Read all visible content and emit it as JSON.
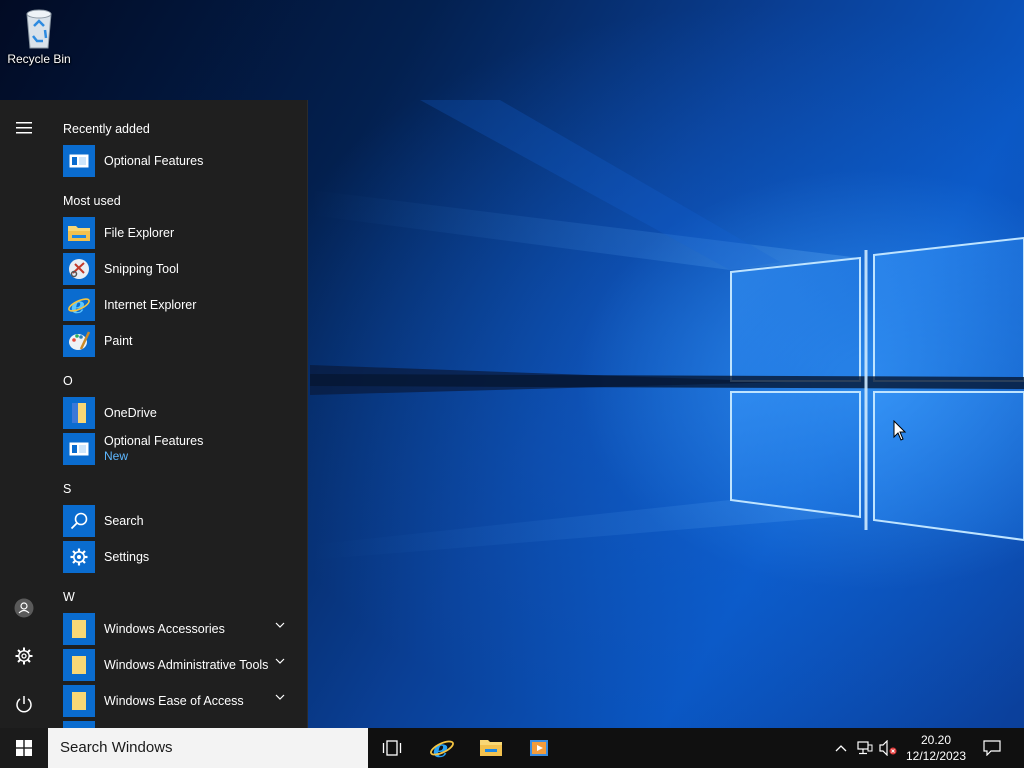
{
  "desktop": {
    "icons": [
      {
        "label": "Recycle Bin",
        "icon": "recycle-bin-icon"
      }
    ]
  },
  "start_menu": {
    "rail": {
      "menu_icon": "hamburger-menu-icon",
      "user_icon": "user-account-icon",
      "settings_icon": "gear-icon",
      "power_icon": "power-icon"
    },
    "groups": {
      "recently_added": {
        "header": "Recently added",
        "items": [
          {
            "label": "Optional Features",
            "icon": "optional-features-icon"
          }
        ]
      },
      "most_used": {
        "header": "Most used",
        "items": [
          {
            "label": "File Explorer",
            "icon": "file-explorer-icon"
          },
          {
            "label": "Snipping Tool",
            "icon": "snipping-tool-icon"
          },
          {
            "label": "Internet Explorer",
            "icon": "internet-explorer-icon"
          },
          {
            "label": "Paint",
            "icon": "paint-icon"
          }
        ]
      },
      "o": {
        "header": "O",
        "items": [
          {
            "label": "OneDrive",
            "icon": "onedrive-icon"
          },
          {
            "label": "Optional Features",
            "sublabel": "New",
            "icon": "optional-features-icon"
          }
        ]
      },
      "s": {
        "header": "S",
        "items": [
          {
            "label": "Search",
            "icon": "search-icon"
          },
          {
            "label": "Settings",
            "icon": "gear-icon"
          }
        ]
      },
      "w": {
        "header": "W",
        "items": [
          {
            "label": "Windows Accessories",
            "icon": "folder-icon",
            "expandable": true
          },
          {
            "label": "Windows Administrative Tools",
            "icon": "folder-icon",
            "expandable": true
          },
          {
            "label": "Windows Ease of Access",
            "icon": "folder-icon",
            "expandable": true
          }
        ]
      }
    }
  },
  "taskbar": {
    "start_icon": "windows-logo-icon",
    "search_placeholder": "Search Windows",
    "pinned": [
      {
        "name": "Task View",
        "icon": "task-view-icon"
      },
      {
        "name": "Internet Explorer",
        "icon": "internet-explorer-icon"
      },
      {
        "name": "File Explorer",
        "icon": "file-explorer-icon"
      },
      {
        "name": "Media Player",
        "icon": "media-player-icon"
      }
    ],
    "tray": {
      "icons": [
        "chevron-up-icon",
        "network-icon",
        "volume-muted-icon"
      ],
      "time": "20.20",
      "date": "12/12/2023",
      "notification_icon": "action-center-icon"
    }
  },
  "colors": {
    "start_menu_bg": "#1f1f1f",
    "tile_blue": "#0a6ccf",
    "accent_link": "#5db7ff",
    "taskbar_bg": "#101010",
    "search_bg": "#f3f3f3"
  }
}
